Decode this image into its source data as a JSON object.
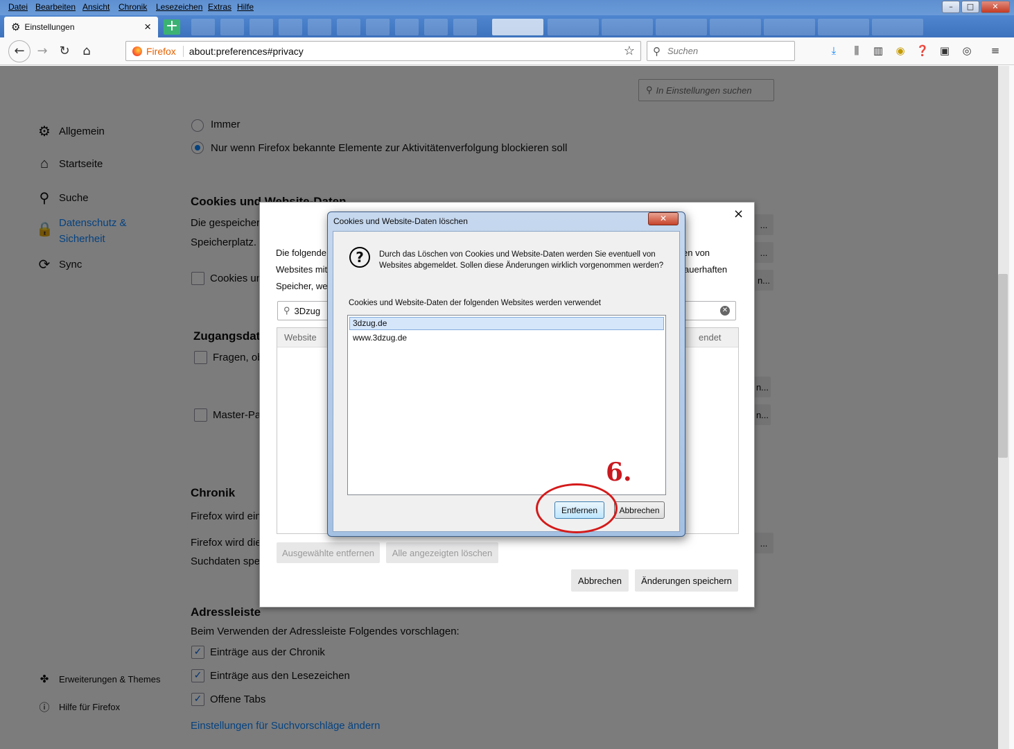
{
  "menu": [
    "Datei",
    "Bearbeiten",
    "Ansicht",
    "Chronik",
    "Lesezeichen",
    "Extras",
    "Hilfe"
  ],
  "tab": {
    "title": "Einstellungen",
    "close": "×"
  },
  "urlbar": {
    "identity": "Firefox",
    "url": "about:preferences#privacy"
  },
  "search": {
    "placeholder": "Suchen"
  },
  "prefs_search": {
    "placeholder": "In Einstellungen suchen"
  },
  "sidebar": {
    "items": [
      {
        "label": "Allgemein",
        "icon": "gear-icon"
      },
      {
        "label": "Startseite",
        "icon": "home-icon"
      },
      {
        "label": "Suche",
        "icon": "search-icon"
      },
      {
        "label": "Datenschutz & Sicherheit",
        "icon": "lock-icon"
      },
      {
        "label": "Sync",
        "icon": "sync-icon"
      }
    ],
    "footer": [
      {
        "label": "Erweiterungen & Themes",
        "icon": "puzzle-icon"
      },
      {
        "label": "Hilfe für Firefox",
        "icon": "help-icon"
      }
    ]
  },
  "privacy": {
    "dnt_always": "Immer",
    "dnt_only": "Nur wenn Firefox bekannte Elemente zur Aktivitätenverfolgung blockieren soll",
    "cookies_heading": "Cookies und Website-Daten",
    "cookies_desc1": "Die gespeicher",
    "cookies_desc2": "Speicherplatz.",
    "cookies_checkbox": "Cookies un",
    "logins_heading": "Zugangsdat",
    "logins_ask": "Fragen, ob",
    "master_pw": "Master-Pa",
    "history_heading": "Chronik",
    "history_line1": "Firefox wird ein",
    "history_line2": "Firefox wird die",
    "history_line3": "Suchdaten spei",
    "addr_heading": "Adressleiste",
    "addr_desc": "Beim Verwenden der Adressleiste Folgendes vorschlagen:",
    "addr_history": "Einträge aus der Chronik",
    "addr_bookmarks": "Einträge aus den Lesezeichen",
    "addr_tabs": "Offene Tabs",
    "addr_link": "Einstellungen für Suchvorschläge ändern"
  },
  "manager": {
    "close": "×",
    "desc_a": "Die folgende",
    "desc_b": "Websites mit",
    "desc_c": "Speicher, wer",
    "desc_r1": "en von",
    "desc_r2": "auerhaften",
    "search_value": "3Dzug",
    "col_site": "Website",
    "col_used": "endet",
    "remove_selected": "Ausgewählte entfernen",
    "remove_all": "Alle angezeigten löschen",
    "cancel": "Abbrechen",
    "save": "Änderungen speichern"
  },
  "dialog": {
    "title": "Cookies und Website-Daten löschen",
    "close": "✕",
    "message": "Durch das Löschen von Cookies und Website-Daten werden Sie eventuell von Websites abgemeldet. Sollen diese Änderungen wirklich vorgenommen werden?",
    "list_label": "Cookies und Website-Daten der folgenden Websites werden verwendet",
    "sites": [
      "3dzug.de",
      "www.3dzug.de"
    ],
    "remove": "Entfernen",
    "cancel": "Abbrechen"
  },
  "annotation": "6.",
  "behind_buttons": [
    "...",
    "...",
    "n...",
    "n...",
    "n...",
    "..."
  ]
}
